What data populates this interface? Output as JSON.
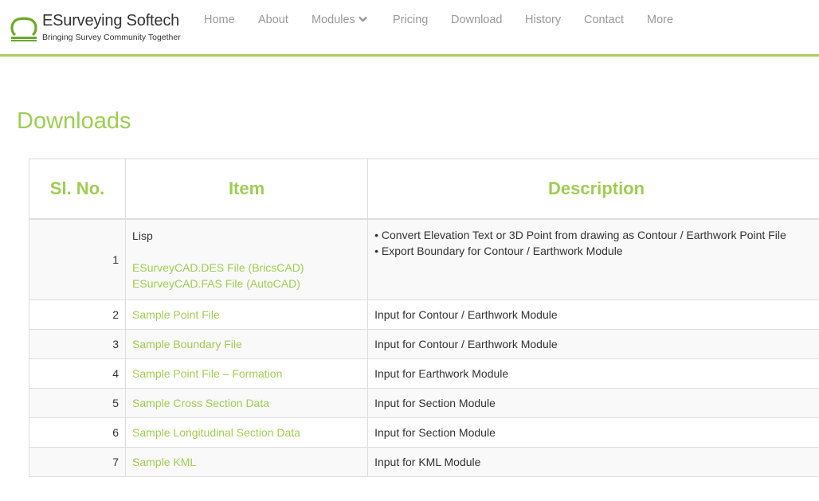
{
  "header": {
    "logo_first": "ESurveying",
    "logo_second": "Softech",
    "tagline": "Bringing Survey Community Together",
    "nav": [
      "Home",
      "About",
      "Modules",
      "Pricing",
      "Download",
      "History",
      "Contact",
      "More"
    ],
    "accent": "#a8cf5a"
  },
  "page": {
    "title": "Downloads"
  },
  "table": {
    "headers": [
      "Sl. No.",
      "Item",
      "Description"
    ],
    "rows": [
      {
        "no": "1",
        "label": "Lisp",
        "links": [
          "ESurveyCAD.DES File (BricsCAD)",
          "ESurveyCAD.FAS File (AutoCAD)"
        ],
        "desc": [
          "• Convert Elevation Text or 3D Point from drawing as Contour / Earthwork Point File",
          "• Export Boundary for Contour / Earthwork Module"
        ]
      },
      {
        "no": "2",
        "item": "Sample Point File",
        "desc": "Input for Contour / Earthwork Module"
      },
      {
        "no": "3",
        "item": "Sample Boundary File",
        "desc": "Input for Contour / Earthwork Module"
      },
      {
        "no": "4",
        "item": "Sample Point File – Formation",
        "desc": "Input for Earthwork Module"
      },
      {
        "no": "5",
        "item": "Sample Cross Section Data",
        "desc": "Input for Section Module"
      },
      {
        "no": "6",
        "item": "Sample Longitudinal Section Data",
        "desc": "Input for Section Module"
      },
      {
        "no": "7",
        "item": "Sample KML",
        "desc": "Input for KML Module"
      }
    ]
  }
}
